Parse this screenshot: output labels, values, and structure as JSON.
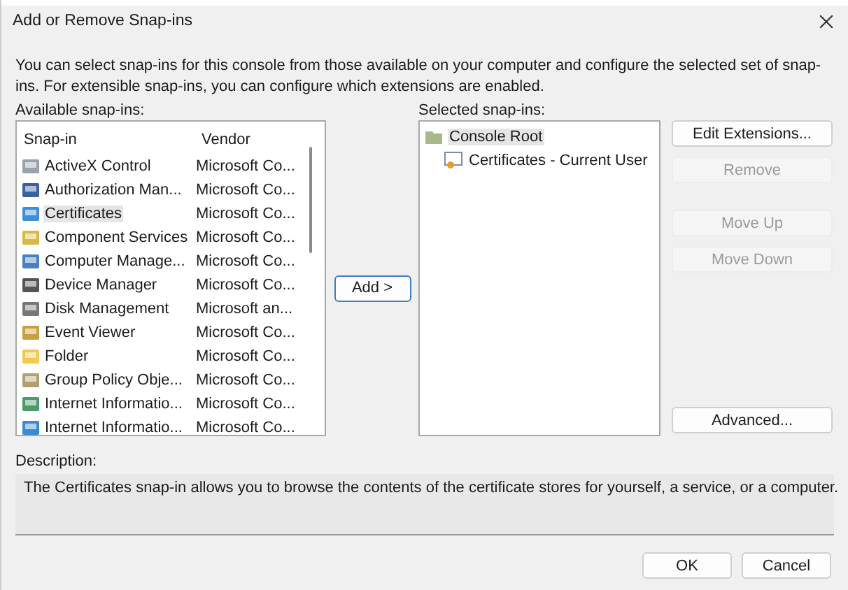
{
  "window": {
    "title": "Add or Remove Snap-ins"
  },
  "intro": "You can select snap-ins for this console from those available on your computer and configure the selected set of snap-ins. For extensible snap-ins, you can configure which extensions are enabled.",
  "available": {
    "label": "Available snap-ins:",
    "columns": [
      "Snap-in",
      "Vendor"
    ],
    "rows": [
      {
        "name": "ActiveX Control",
        "vendor": "Microsoft Co...",
        "selected": false
      },
      {
        "name": "Authorization Man...",
        "vendor": "Microsoft Co...",
        "selected": false
      },
      {
        "name": "Certificates",
        "vendor": "Microsoft Co...",
        "selected": true
      },
      {
        "name": "Component Services",
        "vendor": "Microsoft Co...",
        "selected": false
      },
      {
        "name": "Computer Manage...",
        "vendor": "Microsoft Co...",
        "selected": false
      },
      {
        "name": "Device Manager",
        "vendor": "Microsoft Co...",
        "selected": false
      },
      {
        "name": "Disk Management",
        "vendor": "Microsoft an...",
        "selected": false
      },
      {
        "name": "Event Viewer",
        "vendor": "Microsoft Co...",
        "selected": false
      },
      {
        "name": "Folder",
        "vendor": "Microsoft Co...",
        "selected": false
      },
      {
        "name": "Group Policy Obje...",
        "vendor": "Microsoft Co...",
        "selected": false
      },
      {
        "name": "Internet Informatio...",
        "vendor": "Microsoft Co...",
        "selected": false
      },
      {
        "name": "Internet Informatio...",
        "vendor": "Microsoft Co...",
        "selected": false
      }
    ]
  },
  "add_button": "Add >",
  "selected_snapins": {
    "label": "Selected snap-ins:",
    "tree": [
      {
        "label": "Console Root",
        "selected": true,
        "children": [
          {
            "label": "Certificates - Current User",
            "selected": false
          }
        ]
      }
    ]
  },
  "side_buttons": [
    {
      "label": "Edit Extensions...",
      "disabled": false
    },
    {
      "label": "Remove",
      "disabled": true
    },
    {
      "label": "Move Up",
      "disabled": true
    },
    {
      "label": "Move Down",
      "disabled": true
    },
    {
      "label": "Advanced...",
      "disabled": false
    }
  ],
  "description": {
    "label": "Description:",
    "text": "The Certificates snap-in allows you to browse the contents of the certificate stores for yourself, a service, or a computer."
  },
  "buttons": [
    {
      "label": "OK"
    },
    {
      "label": "Cancel"
    }
  ]
}
